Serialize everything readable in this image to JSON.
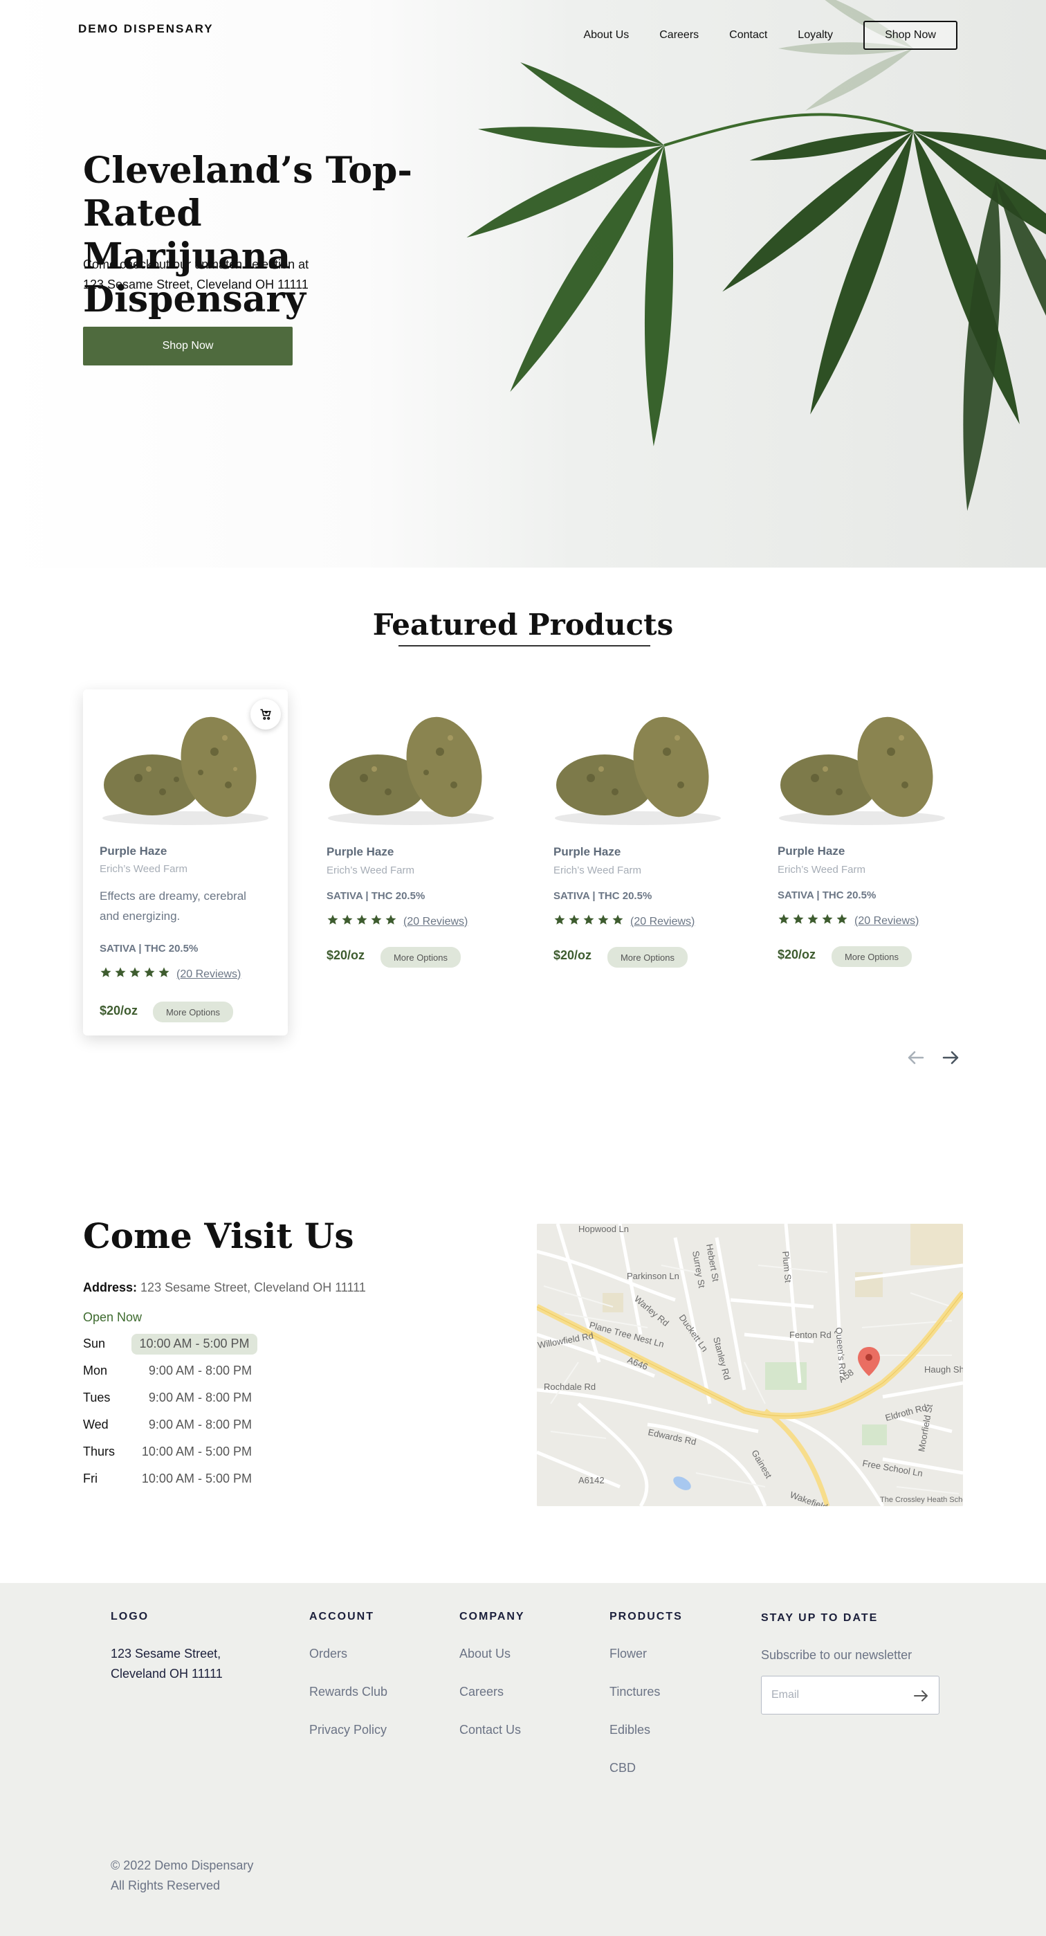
{
  "header": {
    "brand": "DEMO DISPENSARY",
    "nav": [
      "About Us",
      "Careers",
      "Contact",
      "Loyalty"
    ],
    "cta": "Shop Now"
  },
  "hero": {
    "title_line1": "Cleveland’s Top-Rated",
    "title_line2": "Marijuana Dispensary",
    "subtitle_line1": "Come checkout our unmatch selection at",
    "subtitle_line2": "123 Sesame Street, Cleveland OH 11111",
    "cta": "Shop Now"
  },
  "featured": {
    "title": "Featured Products",
    "products": [
      {
        "name": "Purple Haze",
        "farm": "Erich’s Weed Farm",
        "description": "Effects are dreamy, cerebral and energizing.",
        "type": "SATIVA | THC 20.5%",
        "rating": 5,
        "reviews": "(20 Reviews)",
        "price": "$20/oz",
        "more": "More Options"
      },
      {
        "name": "Purple Haze",
        "farm": "Erich’s Weed Farm",
        "type": "SATIVA | THC 20.5%",
        "rating": 5,
        "reviews": "(20 Reviews)",
        "price": "$20/oz",
        "more": "More Options"
      },
      {
        "name": "Purple Haze",
        "farm": "Erich’s Weed Farm",
        "type": "SATIVA | THC 20.5%",
        "rating": 5,
        "reviews": "(20 Reviews)",
        "price": "$20/oz",
        "more": "More Options"
      },
      {
        "name": "Purple Haze",
        "farm": "Erich’s Weed Farm",
        "type": "SATIVA | THC 20.5%",
        "rating": 5,
        "reviews": "(20 Reviews)",
        "price": "$20/oz",
        "more": "More Options"
      }
    ],
    "icons": {
      "cart": "add-to-cart-icon",
      "prev": "arrow-left-icon",
      "next": "arrow-right-icon"
    }
  },
  "visit": {
    "title": "Come Visit Us",
    "address_label": "Address:",
    "address": "123 Sesame Street, Cleveland OH 11111",
    "open_status": "Open Now",
    "hours": [
      {
        "day": "Sun",
        "time": "10:00 AM - 5:00 PM"
      },
      {
        "day": "Mon",
        "time": "9:00 AM - 8:00 PM"
      },
      {
        "day": "Tues",
        "time": "9:00 AM - 8:00 PM"
      },
      {
        "day": "Wed",
        "time": "9:00 AM - 8:00 PM"
      },
      {
        "day": "Thurs",
        "time": "10:00 AM - 5:00 PM"
      },
      {
        "day": "Fri",
        "time": "10:00 AM - 5:00 PM"
      }
    ],
    "map_labels": [
      "Hopwood Ln",
      "Parkinson Ln",
      "Plane Tree Nest Ln",
      "Rochdale Rd",
      "Edwards Rd",
      "Free School Ln",
      "A646",
      "A58",
      "Haugh Sh",
      "Eldroth Rd",
      "Fenton Rd",
      "The Crossley Heath School",
      "Warley Rd",
      "Duckett Ln",
      "Stanley Rd",
      "Queen's Rd",
      "A6142",
      "Gainest",
      "Moorfield St",
      "Willowfield Rd",
      "Plum St",
      "Surrey St",
      "Hebert St",
      "Wakefield G"
    ]
  },
  "footer": {
    "logo": "LOGO",
    "address_line1": "123 Sesame Street,",
    "address_line2": "Cleveland OH 11111",
    "columns": [
      {
        "heading": "ACCOUNT",
        "items": [
          "Orders",
          "Rewards Club",
          "Privacy Policy"
        ]
      },
      {
        "heading": "COMPANY",
        "items": [
          "About Us",
          "Careers",
          "Contact Us"
        ]
      },
      {
        "heading": "PRODUCTS",
        "items": [
          "Flower",
          "Tinctures",
          "Edibles",
          "CBD"
        ]
      }
    ],
    "newsletter_heading": "STAY UP TO DATE",
    "newsletter_text": "Subscribe to our newsletter",
    "email_placeholder": "Email",
    "copyright": "© 2022 Demo Dispensary",
    "rights": "All Rights Reserved"
  },
  "colors": {
    "brand_green": "#4f6b3e",
    "price_green": "#3e5c2f",
    "footer_bg": "#eeefec",
    "pill_bg": "#dfe6da"
  }
}
